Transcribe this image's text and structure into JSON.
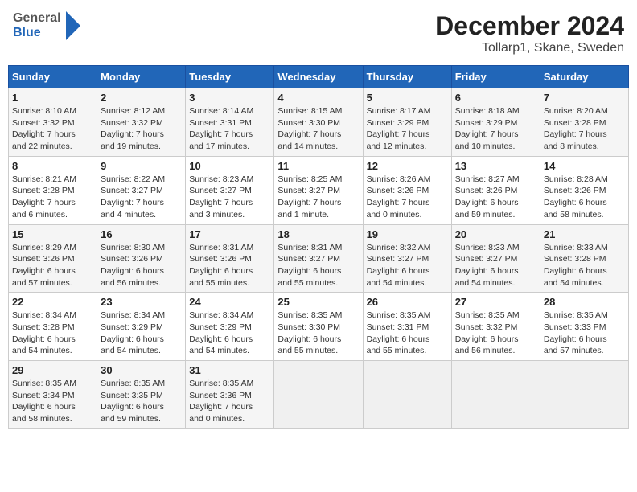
{
  "header": {
    "logo_general": "General",
    "logo_blue": "Blue",
    "title": "December 2024",
    "subtitle": "Tollarp1, Skane, Sweden"
  },
  "columns": [
    "Sunday",
    "Monday",
    "Tuesday",
    "Wednesday",
    "Thursday",
    "Friday",
    "Saturday"
  ],
  "weeks": [
    [
      {
        "day": "1",
        "info": "Sunrise: 8:10 AM\nSunset: 3:32 PM\nDaylight: 7 hours\nand 22 minutes."
      },
      {
        "day": "2",
        "info": "Sunrise: 8:12 AM\nSunset: 3:32 PM\nDaylight: 7 hours\nand 19 minutes."
      },
      {
        "day": "3",
        "info": "Sunrise: 8:14 AM\nSunset: 3:31 PM\nDaylight: 7 hours\nand 17 minutes."
      },
      {
        "day": "4",
        "info": "Sunrise: 8:15 AM\nSunset: 3:30 PM\nDaylight: 7 hours\nand 14 minutes."
      },
      {
        "day": "5",
        "info": "Sunrise: 8:17 AM\nSunset: 3:29 PM\nDaylight: 7 hours\nand 12 minutes."
      },
      {
        "day": "6",
        "info": "Sunrise: 8:18 AM\nSunset: 3:29 PM\nDaylight: 7 hours\nand 10 minutes."
      },
      {
        "day": "7",
        "info": "Sunrise: 8:20 AM\nSunset: 3:28 PM\nDaylight: 7 hours\nand 8 minutes."
      }
    ],
    [
      {
        "day": "8",
        "info": "Sunrise: 8:21 AM\nSunset: 3:28 PM\nDaylight: 7 hours\nand 6 minutes."
      },
      {
        "day": "9",
        "info": "Sunrise: 8:22 AM\nSunset: 3:27 PM\nDaylight: 7 hours\nand 4 minutes."
      },
      {
        "day": "10",
        "info": "Sunrise: 8:23 AM\nSunset: 3:27 PM\nDaylight: 7 hours\nand 3 minutes."
      },
      {
        "day": "11",
        "info": "Sunrise: 8:25 AM\nSunset: 3:27 PM\nDaylight: 7 hours\nand 1 minute."
      },
      {
        "day": "12",
        "info": "Sunrise: 8:26 AM\nSunset: 3:26 PM\nDaylight: 7 hours\nand 0 minutes."
      },
      {
        "day": "13",
        "info": "Sunrise: 8:27 AM\nSunset: 3:26 PM\nDaylight: 6 hours\nand 59 minutes."
      },
      {
        "day": "14",
        "info": "Sunrise: 8:28 AM\nSunset: 3:26 PM\nDaylight: 6 hours\nand 58 minutes."
      }
    ],
    [
      {
        "day": "15",
        "info": "Sunrise: 8:29 AM\nSunset: 3:26 PM\nDaylight: 6 hours\nand 57 minutes."
      },
      {
        "day": "16",
        "info": "Sunrise: 8:30 AM\nSunset: 3:26 PM\nDaylight: 6 hours\nand 56 minutes."
      },
      {
        "day": "17",
        "info": "Sunrise: 8:31 AM\nSunset: 3:26 PM\nDaylight: 6 hours\nand 55 minutes."
      },
      {
        "day": "18",
        "info": "Sunrise: 8:31 AM\nSunset: 3:27 PM\nDaylight: 6 hours\nand 55 minutes."
      },
      {
        "day": "19",
        "info": "Sunrise: 8:32 AM\nSunset: 3:27 PM\nDaylight: 6 hours\nand 54 minutes."
      },
      {
        "day": "20",
        "info": "Sunrise: 8:33 AM\nSunset: 3:27 PM\nDaylight: 6 hours\nand 54 minutes."
      },
      {
        "day": "21",
        "info": "Sunrise: 8:33 AM\nSunset: 3:28 PM\nDaylight: 6 hours\nand 54 minutes."
      }
    ],
    [
      {
        "day": "22",
        "info": "Sunrise: 8:34 AM\nSunset: 3:28 PM\nDaylight: 6 hours\nand 54 minutes."
      },
      {
        "day": "23",
        "info": "Sunrise: 8:34 AM\nSunset: 3:29 PM\nDaylight: 6 hours\nand 54 minutes."
      },
      {
        "day": "24",
        "info": "Sunrise: 8:34 AM\nSunset: 3:29 PM\nDaylight: 6 hours\nand 54 minutes."
      },
      {
        "day": "25",
        "info": "Sunrise: 8:35 AM\nSunset: 3:30 PM\nDaylight: 6 hours\nand 55 minutes."
      },
      {
        "day": "26",
        "info": "Sunrise: 8:35 AM\nSunset: 3:31 PM\nDaylight: 6 hours\nand 55 minutes."
      },
      {
        "day": "27",
        "info": "Sunrise: 8:35 AM\nSunset: 3:32 PM\nDaylight: 6 hours\nand 56 minutes."
      },
      {
        "day": "28",
        "info": "Sunrise: 8:35 AM\nSunset: 3:33 PM\nDaylight: 6 hours\nand 57 minutes."
      }
    ],
    [
      {
        "day": "29",
        "info": "Sunrise: 8:35 AM\nSunset: 3:34 PM\nDaylight: 6 hours\nand 58 minutes."
      },
      {
        "day": "30",
        "info": "Sunrise: 8:35 AM\nSunset: 3:35 PM\nDaylight: 6 hours\nand 59 minutes."
      },
      {
        "day": "31",
        "info": "Sunrise: 8:35 AM\nSunset: 3:36 PM\nDaylight: 7 hours\nand 0 minutes."
      },
      {
        "day": "",
        "info": ""
      },
      {
        "day": "",
        "info": ""
      },
      {
        "day": "",
        "info": ""
      },
      {
        "day": "",
        "info": ""
      }
    ]
  ]
}
